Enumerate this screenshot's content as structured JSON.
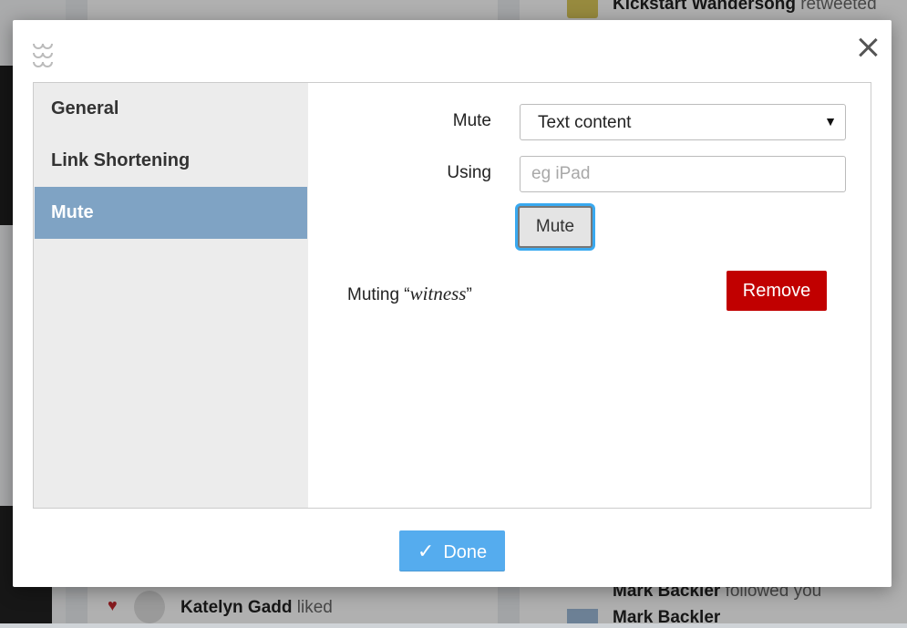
{
  "background": {
    "top_right_name": "Kickstart Wandersong",
    "top_right_action": "retweeted",
    "bottom_mid_name": "Katelyn Gadd",
    "bottom_mid_action": "liked",
    "bottom_right_name": "Mark Backler",
    "bottom_right_action": "followed you",
    "bottom_right_name2": "Mark Backler"
  },
  "sidebar": {
    "items": [
      {
        "label": "General"
      },
      {
        "label": "Link Shortening"
      },
      {
        "label": "Mute"
      }
    ],
    "active_index": 2
  },
  "mute_form": {
    "mute_label": "Mute",
    "mute_select_value": "Text content",
    "using_label": "Using",
    "using_placeholder": "eg iPad",
    "using_value": "",
    "mute_button_label": "Mute"
  },
  "muted_list": [
    {
      "prefix": "Muting",
      "term": "witness",
      "remove_label": "Remove"
    }
  ],
  "footer": {
    "done_label": "Done"
  },
  "colors": {
    "active_nav": "#7fa3c4",
    "remove_button": "#c10000",
    "done_button": "#55acee",
    "focus_ring": "#39a9f0"
  },
  "icons": {
    "close": "close-icon",
    "drag": "drag-handle-icon",
    "done": "checkmark-icon"
  }
}
